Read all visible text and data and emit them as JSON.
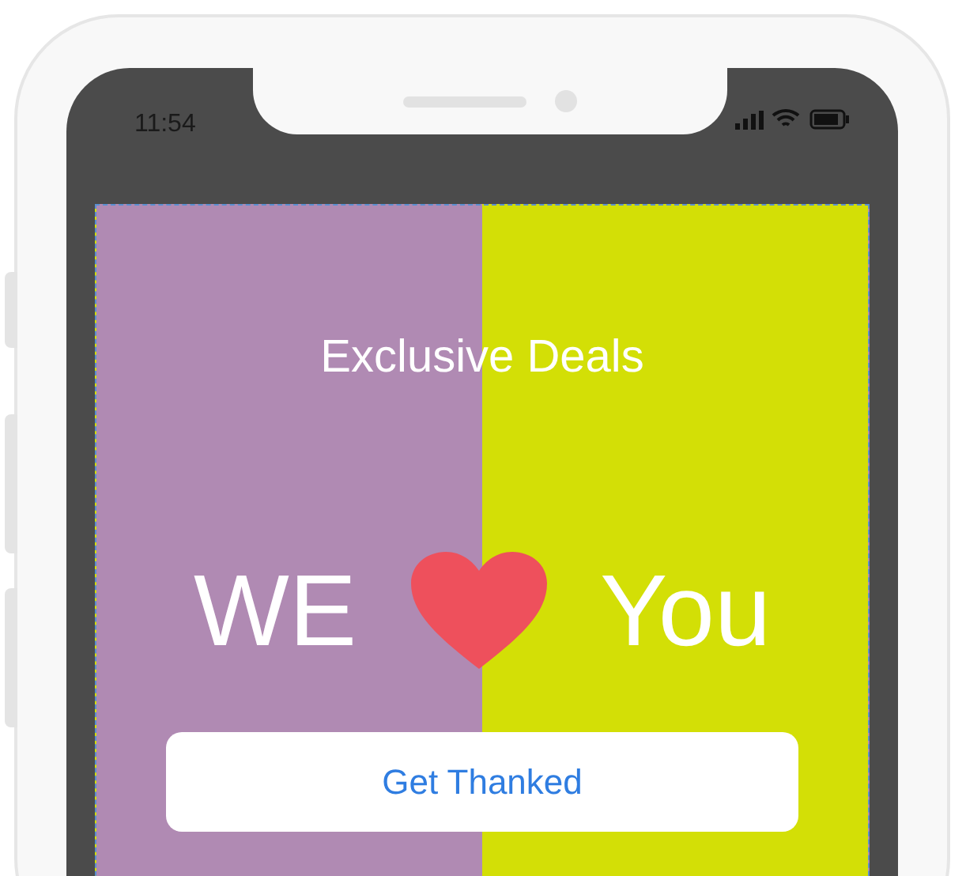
{
  "status_bar": {
    "time": "11:54"
  },
  "banner": {
    "title": "Exclusive Deals",
    "headline_left": "WE",
    "headline_right": "You",
    "button": "Get Thanked"
  }
}
